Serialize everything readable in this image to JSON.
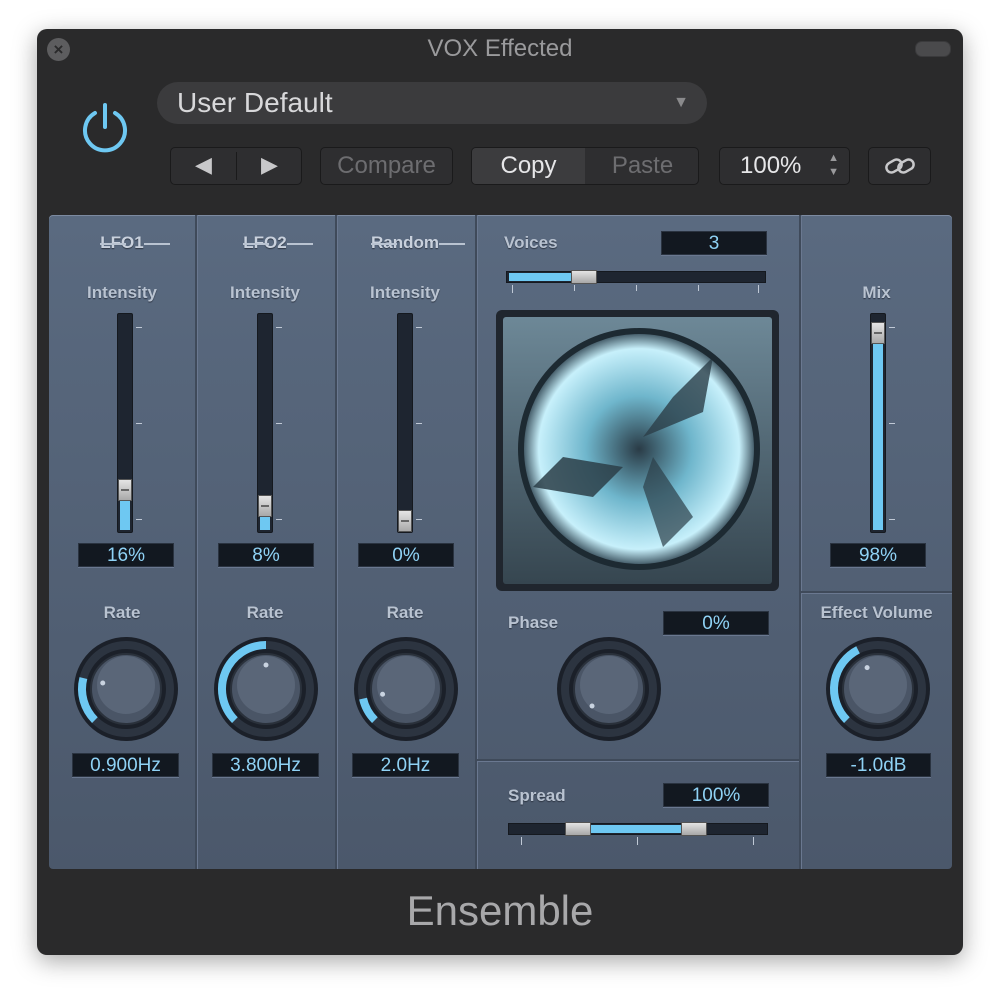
{
  "window": {
    "title": "VOX Effected",
    "plugin_name": "Ensemble"
  },
  "header": {
    "preset": "User Default",
    "compare_label": "Compare",
    "copy_label": "Copy",
    "paste_label": "Paste",
    "zoom": "100%"
  },
  "lfo1": {
    "title": "LFO1",
    "intensity_label": "Intensity",
    "intensity": "16%",
    "intensity_level": 0.16,
    "rate_label": "Rate",
    "rate": "0.900Hz"
  },
  "lfo2": {
    "title": "LFO2",
    "intensity_label": "Intensity",
    "intensity": "8%",
    "intensity_level": 0.08,
    "rate_label": "Rate",
    "rate": "3.800Hz"
  },
  "random": {
    "title": "Random",
    "intensity_label": "Intensity",
    "intensity": "0%",
    "intensity_level": 0.0,
    "rate_label": "Rate",
    "rate": "2.0Hz"
  },
  "voices": {
    "label": "Voices",
    "value": "3"
  },
  "phase": {
    "label": "Phase",
    "value": "0%"
  },
  "spread": {
    "label": "Spread",
    "value": "100%"
  },
  "mix": {
    "label": "Mix",
    "value": "98%",
    "level": 0.98
  },
  "effect_volume": {
    "label": "Effect Volume",
    "value": "-1.0dB"
  },
  "colors": {
    "accent": "#6ec8f2",
    "panel": "#536073",
    "window": "#2a2a2b"
  }
}
